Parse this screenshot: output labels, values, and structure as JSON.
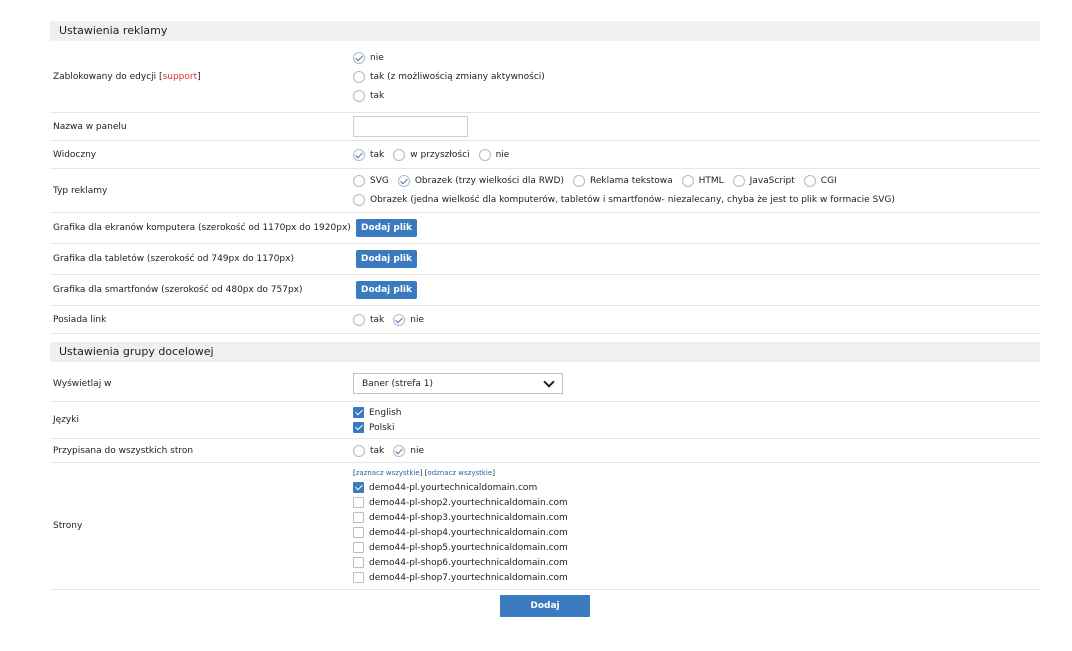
{
  "ad_settings": {
    "title": "Ustawienia reklamy",
    "locked": {
      "label": "Zablokowany do edycji",
      "label_bracket_open": "[",
      "label_link": "support",
      "label_bracket_close": "]",
      "options": [
        "nie",
        "tak (z możliwością zmiany aktywności)",
        "tak"
      ],
      "selected": "nie"
    },
    "panel_name": {
      "label": "Nazwa w panelu",
      "value": ""
    },
    "visible": {
      "label": "Widoczny",
      "options": [
        "tak",
        "w przyszłości",
        "nie"
      ],
      "selected": "tak"
    },
    "ad_type": {
      "label": "Typ reklamy",
      "options_row1": [
        "SVG",
        "Obrazek (trzy wielkości dla RWD)",
        "Reklama tekstowa",
        "HTML",
        "JavaScript",
        "CGI"
      ],
      "options_row2": [
        "Obrazek (jedna wielkość dla komputerów, tabletów i smartfonów- niezalecany, chyba że jest to plik w formacie SVG)"
      ],
      "selected": "Obrazek (trzy wielkości dla RWD)"
    },
    "desktop_graphic": {
      "label": "Grafika dla ekranów komputera (szerokość od 1170px do 1920px)",
      "button": "Dodaj plik"
    },
    "tablet_graphic": {
      "label": "Grafika dla tabletów (szerokość od 749px do 1170px)",
      "button": "Dodaj plik"
    },
    "phone_graphic": {
      "label": "Grafika dla smartfonów (szerokość od 480px do 757px)",
      "button": "Dodaj plik"
    },
    "has_link": {
      "label": "Posiada link",
      "options": [
        "tak",
        "nie"
      ],
      "selected": "nie"
    }
  },
  "target_settings": {
    "title": "Ustawienia grupy docelowej",
    "display_in": {
      "label": "Wyświetlaj w",
      "selected": "Baner (strefa 1)"
    },
    "languages": {
      "label": "Języki",
      "items": [
        {
          "name": "English",
          "checked": true
        },
        {
          "name": "Polski",
          "checked": true
        }
      ]
    },
    "all_pages": {
      "label": "Przypisana do wszystkich stron",
      "options": [
        "tak",
        "nie"
      ],
      "selected": "nie"
    },
    "pages": {
      "label": "Strony",
      "bracket_open": "[",
      "select_all": "zaznacz wszystkie",
      "bracket_mid": "] [",
      "deselect_all": "odznacz wszystkie",
      "bracket_close": "]",
      "items": [
        {
          "name": "demo44-pl.yourtechnicaldomain.com",
          "checked": true
        },
        {
          "name": "demo44-pl-shop2.yourtechnicaldomain.com",
          "checked": false
        },
        {
          "name": "demo44-pl-shop3.yourtechnicaldomain.com",
          "checked": false
        },
        {
          "name": "demo44-pl-shop4.yourtechnicaldomain.com",
          "checked": false
        },
        {
          "name": "demo44-pl-shop5.yourtechnicaldomain.com",
          "checked": false
        },
        {
          "name": "demo44-pl-shop6.yourtechnicaldomain.com",
          "checked": false
        },
        {
          "name": "demo44-pl-shop7.yourtechnicaldomain.com",
          "checked": false
        }
      ]
    }
  },
  "submit_label": "Dodaj",
  "colors": {
    "accent": "#3a7bbf",
    "section_bg": "#f0f0f0",
    "support_link": "#e0302a"
  }
}
